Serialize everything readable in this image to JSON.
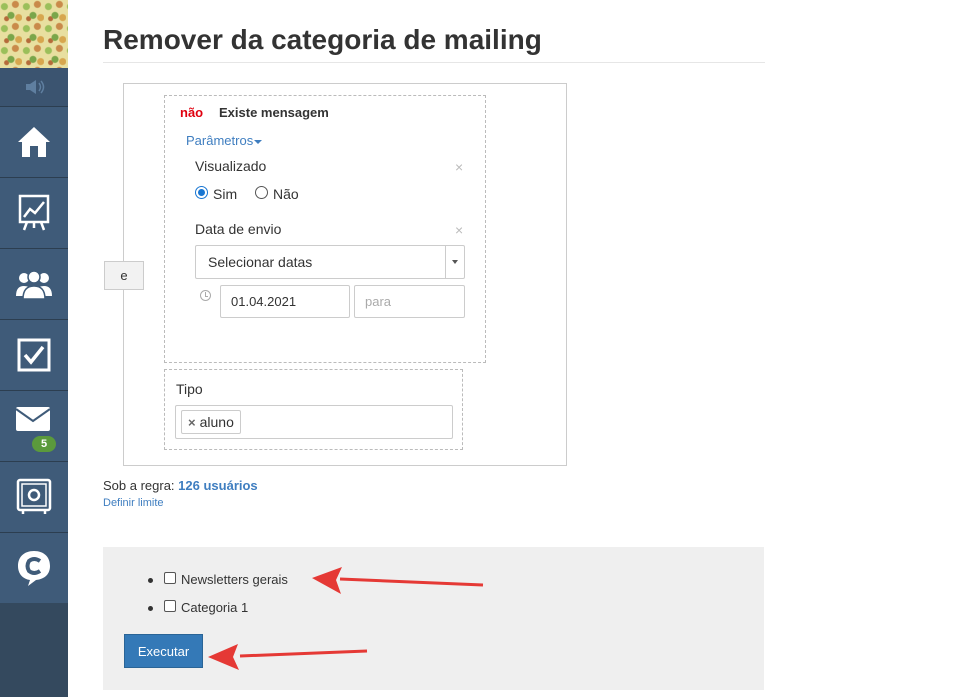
{
  "page": {
    "title": "Remover da categoria de mailing"
  },
  "sidebar": {
    "items": [
      {
        "icon": "home-icon"
      },
      {
        "icon": "chart-icon"
      },
      {
        "icon": "users-icon"
      },
      {
        "icon": "tasks-icon"
      },
      {
        "icon": "mail-icon",
        "badge": "5"
      },
      {
        "icon": "safe-icon"
      },
      {
        "icon": "chat-icon"
      }
    ]
  },
  "rule": {
    "join_label": "e",
    "condition": {
      "negation": "não",
      "title": "Existe mensagem",
      "params_link": "Parâmetros",
      "viewed": {
        "label": "Visualizado",
        "options": [
          "Sim",
          "Não"
        ],
        "selected": "Sim"
      },
      "send_date": {
        "label": "Data de envio",
        "select_value": "Selecionar datas",
        "date_from": "01.04.2021",
        "date_to_placeholder": "para"
      },
      "close_symbol": "×"
    },
    "tipo": {
      "label": "Tipo",
      "tag": "aluno",
      "tag_remove": "×"
    }
  },
  "summary": {
    "prefix": "Sob a regra:",
    "count": "126 usuários",
    "limit_link": "Definir limite"
  },
  "categories": {
    "items": [
      "Newsletters gerais",
      "Categoria 1"
    ],
    "execute_label": "Executar"
  },
  "colors": {
    "sidebar": "#34495e",
    "link": "#3f7ec0",
    "negation": "#e0000f",
    "button": "#3479b7",
    "badge": "#5b9a3c",
    "annotation_arrow": "#e53935"
  }
}
